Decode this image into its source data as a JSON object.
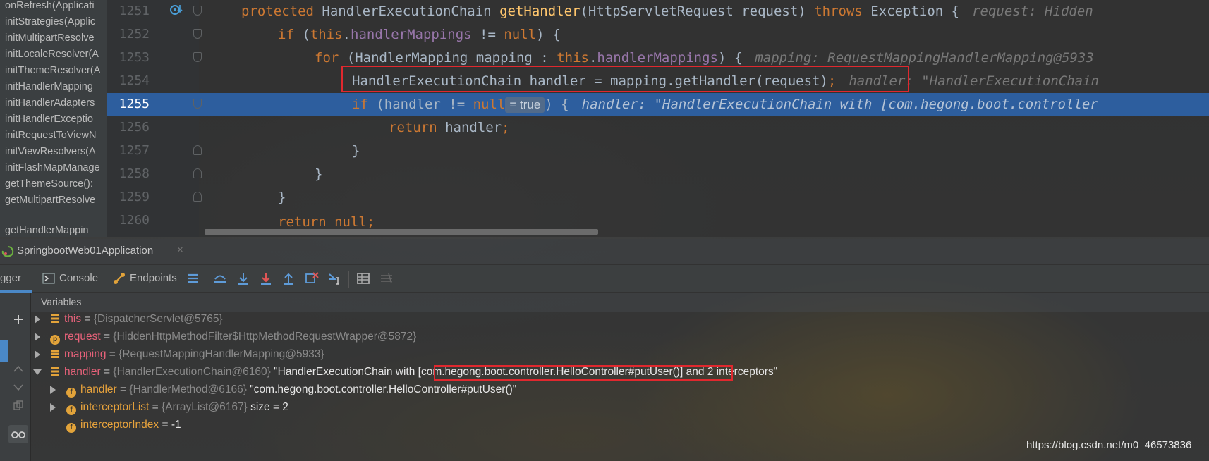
{
  "structure": {
    "items": [
      "onRefresh(Applicati",
      "initStrategies(Applic",
      "initMultipartResolve",
      "initLocaleResolver(A",
      "initThemeResolver(A",
      "initHandlerMapping",
      "initHandlerAdapters",
      "initHandlerExceptio",
      "initRequestToViewN",
      "initViewResolvers(A",
      "initFlashMapManage",
      "getThemeSource():",
      "getMultipartResolve",
      "getHandlerMappin"
    ]
  },
  "editor": {
    "line_numbers": [
      "1251",
      "1252",
      "1253",
      "1254",
      "1255",
      "1256",
      "1257",
      "1258",
      "1259",
      "1260"
    ],
    "current_line": "1255",
    "lines": {
      "l1251": {
        "kw1": "protected ",
        "t1": "HandlerExecutionChain ",
        "fn": "getHandler",
        "t2": "(HttpServletRequest request) ",
        "kw2": "throws ",
        "t3": "Exception {",
        "hint": "request: Hidden"
      },
      "l1252": {
        "kw1": "if ",
        "t1": "(",
        "kw2": "this",
        "t2": ".",
        "field": "handlerMappings",
        "t3": " != ",
        "kw3": "null",
        "t4": ") {"
      },
      "l1253": {
        "kw1": "for ",
        "t1": "(HandlerMapping mapping : ",
        "kw2": "this",
        "t2": ".",
        "field": "handlerMappings",
        "t3": ") {",
        "hint": "mapping: RequestMappingHandlerMapping@5933"
      },
      "l1254": {
        "t1": "HandlerExecutionChain handler = mapping.getHandler(request)",
        "semi": ";",
        "hint": "handler: \"HandlerExecutionChain"
      },
      "l1255": {
        "kw1": "if ",
        "t1": "(handler != ",
        "kw2": "null",
        "inline_value": "= true",
        "t2": ") {",
        "hint": "handler: \"HandlerExecutionChain with [com.hegong.boot.controller"
      },
      "l1256": {
        "kw1": "return ",
        "t1": "handler",
        "semi": ";"
      },
      "l1257": {
        "t1": "}"
      },
      "l1258": {
        "t1": "}"
      },
      "l1259": {
        "t1": "}"
      },
      "l1260": {
        "kw1": "return ",
        "kw2": "null",
        "semi": ";"
      }
    }
  },
  "run_panel": {
    "config_name": "SpringbootWeb01Application",
    "close_glyph": "×"
  },
  "debug_toolbar": {
    "tabs": [
      "gger",
      "Console",
      "Endpoints"
    ],
    "buttons": [
      "menu-icon",
      "show-execution-point-icon",
      "step-over-icon",
      "step-into-icon",
      "force-step-into-icon",
      "step-out-icon",
      "drop-frame-icon",
      "run-to-cursor-icon",
      "evaluate-expression-icon",
      "trace-current-stream-icon"
    ]
  },
  "variables": {
    "header": "Variables",
    "rows": [
      {
        "name": "this",
        "eq": " = ",
        "type": "{DispatcherServlet@5765}",
        "value": "",
        "icon": "field-list-icon",
        "icon_label": "",
        "expandable": "collapsed"
      },
      {
        "name": "request",
        "eq": " = ",
        "type": "{HiddenHttpMethodFilter$HttpMethodRequestWrapper@5872}",
        "value": "",
        "icon": "parameter-icon",
        "icon_label": "p",
        "expandable": "collapsed"
      },
      {
        "name": "mapping",
        "eq": " = ",
        "type": "{RequestMappingHandlerMapping@5933}",
        "value": "",
        "icon": "field-list-icon",
        "icon_label": "",
        "expandable": "collapsed"
      },
      {
        "name": "handler",
        "eq": " = ",
        "type": "{HandlerExecutionChain@6160}",
        "value": " \"HandlerExecutionChain with [com.hegong.boot.controller.HelloController#putUser()] and 2 interceptors\"",
        "icon": "field-list-icon",
        "icon_label": "",
        "expandable": "expanded"
      },
      {
        "name": "handler",
        "eq": " = ",
        "type": "{HandlerMethod@6166}",
        "value": " \"com.hegong.boot.controller.HelloController#putUser()\"",
        "icon": "field-icon",
        "icon_label": "f",
        "expandable": "collapsed"
      },
      {
        "name": "interceptorList",
        "eq": " = ",
        "type": "{ArrayList@6167}",
        "value": "  size = 2",
        "icon": "field-icon",
        "icon_label": "f",
        "expandable": "collapsed"
      },
      {
        "name": "interceptorIndex",
        "eq": " = ",
        "type": "",
        "value": "-1",
        "icon": "field-icon",
        "icon_label": "f",
        "expandable": "none"
      }
    ]
  },
  "watermark": "https://blog.csdn.net/m0_46573836",
  "colors": {
    "keyword": "#cc7832",
    "method": "#ffc66d",
    "field": "#9876aa",
    "execution_line": "#2d5e9e",
    "highlight_box": "#e0282e",
    "var_name": "#e8627a"
  }
}
